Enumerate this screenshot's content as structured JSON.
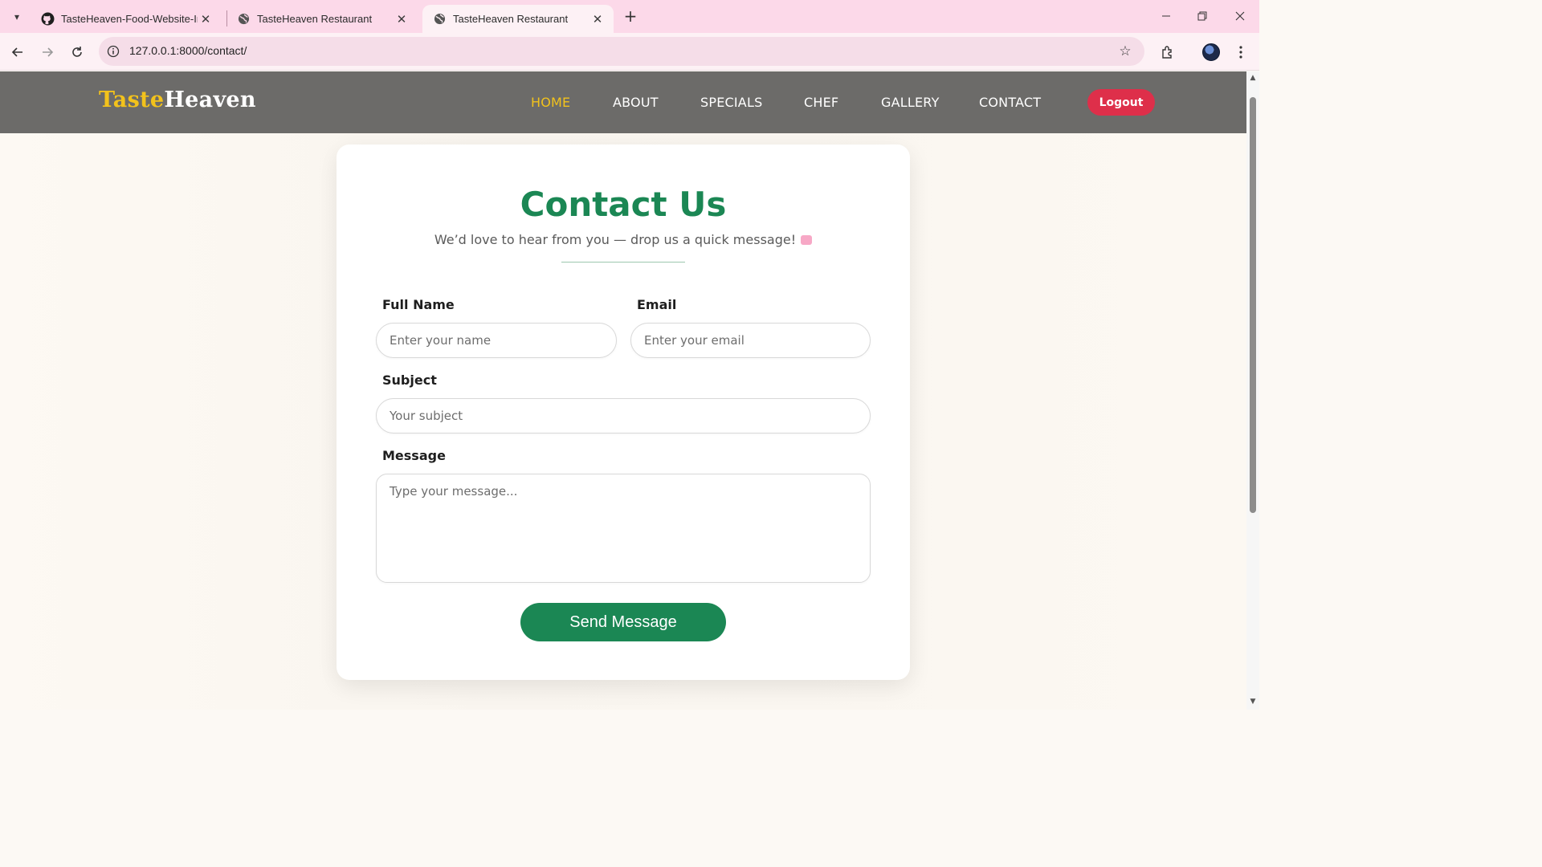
{
  "browser": {
    "tabs": [
      {
        "title": "TasteHeaven-Food-Website-In-",
        "icon": "github-icon"
      },
      {
        "title": "TasteHeaven Restaurant",
        "icon": "globe-icon"
      },
      {
        "title": "TasteHeaven Restaurant",
        "icon": "globe-icon",
        "active": true
      }
    ],
    "url": "127.0.0.1:8000/contact/"
  },
  "site": {
    "logo_part1": "Taste",
    "logo_part2": "Heaven",
    "nav": [
      "HOME",
      "ABOUT",
      "SPECIALS",
      "CHEF",
      "GALLERY",
      "CONTACT"
    ],
    "active_nav": "HOME",
    "logout_label": "Logout"
  },
  "contact": {
    "title": "Contact Us",
    "subtitle": "We’d love to hear from you — drop us a quick message!",
    "name_label": "Full Name",
    "name_placeholder": "Enter your name",
    "email_label": "Email",
    "email_placeholder": "Enter your email",
    "subject_label": "Subject",
    "subject_placeholder": "Your subject",
    "message_label": "Message",
    "message_placeholder": "Type your message...",
    "send_label": "Send Message"
  },
  "colors": {
    "tabstrip": "#fcd9e9",
    "header": "#6c6b69",
    "logo_accent": "#f2c21c",
    "primary_green": "#1b8754",
    "logout_red": "#de2f4a"
  }
}
